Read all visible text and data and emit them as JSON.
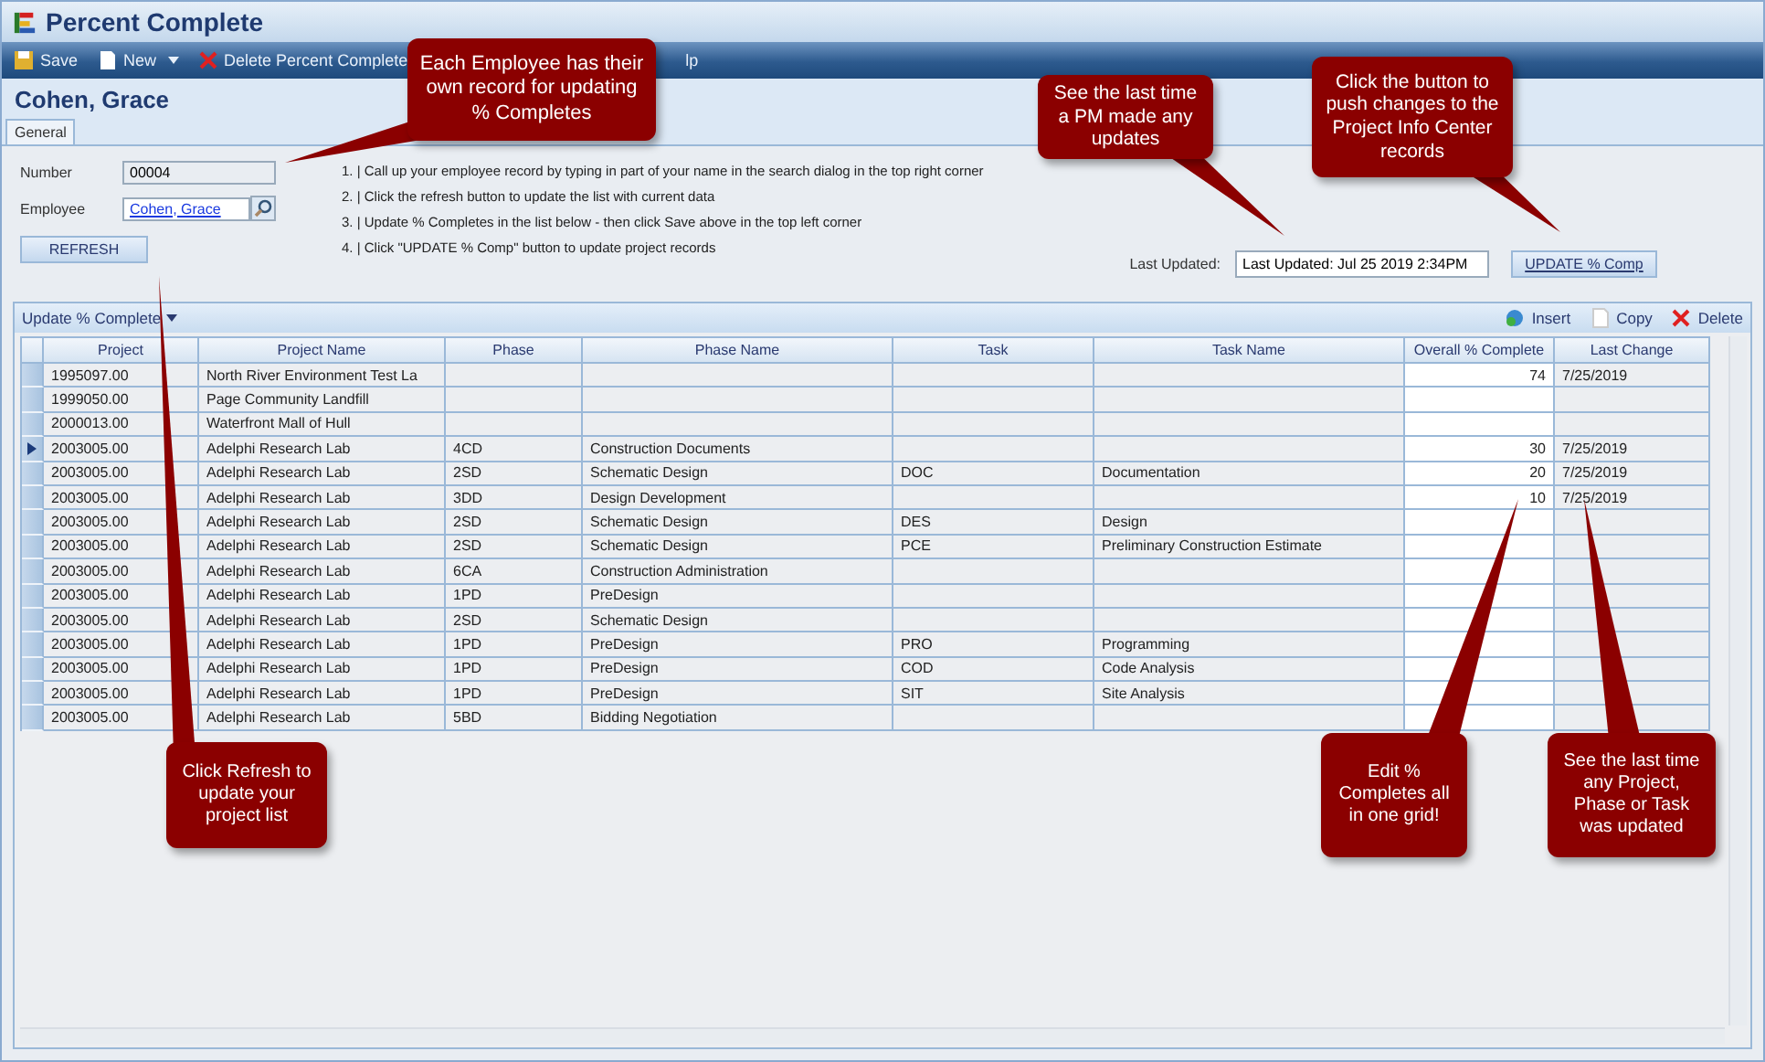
{
  "window": {
    "title": "Percent Complete"
  },
  "toolbar": [
    {
      "label": "Save",
      "kind": "save",
      "dropdown": false
    },
    {
      "label": "New",
      "kind": "new",
      "dropdown": true
    },
    {
      "label": "Delete Percent Complete",
      "kind": "delete",
      "dropdown": false
    },
    {
      "label": "lp",
      "kind": "plain",
      "dropdown": false
    }
  ],
  "record_title": "Cohen, Grace",
  "tabs": [
    {
      "label": "General",
      "selected": true
    }
  ],
  "form": {
    "number_label": "Number",
    "number_value": "00004",
    "employee_label": "Employee",
    "employee_value": "Cohen, Grace",
    "refresh_button": "REFRESH"
  },
  "instructions": [
    "1. | Call up your employee record by typing in part of your name in the search dialog in the top right corner",
    "2. | Click the refresh button to update the list with current data",
    "3. | Update % Completes in the list below - then click Save above in the top left corner",
    "4. | Click \"UPDATE % Comp\" button to update project records"
  ],
  "last_updated": {
    "label": "Last Updated:",
    "value": "Last Updated: Jul 25 2019  2:34PM"
  },
  "update_button": "UPDATE % Comp",
  "grid": {
    "title": "Update % Complete",
    "actions": [
      {
        "label": "Insert",
        "kind": "insert"
      },
      {
        "label": "Copy",
        "kind": "copy"
      },
      {
        "label": "Delete",
        "kind": "delete"
      }
    ],
    "columns": [
      {
        "label": "Project",
        "kind": "text"
      },
      {
        "label": "Project Name",
        "kind": "text"
      },
      {
        "label": "Phase",
        "kind": "text"
      },
      {
        "label": "Phase Name",
        "kind": "text"
      },
      {
        "label": "Task",
        "kind": "text"
      },
      {
        "label": "Task Name",
        "kind": "text"
      },
      {
        "label": "Overall % Complete",
        "kind": "editable"
      },
      {
        "label": "Last Change",
        "kind": "text"
      }
    ],
    "rows": [
      {
        "current": false,
        "cells": [
          "1995097.00",
          "North River Environment Test La",
          "",
          "",
          "",
          "",
          "74",
          "7/25/2019"
        ]
      },
      {
        "current": false,
        "cells": [
          "1999050.00",
          "Page Community Landfill",
          "",
          "",
          "",
          "",
          "",
          ""
        ]
      },
      {
        "current": false,
        "cells": [
          "2000013.00",
          "Waterfront Mall of Hull",
          "",
          "",
          "",
          "",
          "",
          ""
        ]
      },
      {
        "current": true,
        "cells": [
          "2003005.00",
          "Adelphi Research Lab",
          "4CD",
          "Construction Documents",
          "",
          "",
          "30",
          "7/25/2019"
        ]
      },
      {
        "current": false,
        "cells": [
          "2003005.00",
          "Adelphi Research Lab",
          "2SD",
          "Schematic Design",
          "DOC",
          "Documentation",
          "20",
          "7/25/2019"
        ]
      },
      {
        "current": false,
        "cells": [
          "2003005.00",
          "Adelphi Research Lab",
          "3DD",
          "Design Development",
          "",
          "",
          "10",
          "7/25/2019"
        ]
      },
      {
        "current": false,
        "cells": [
          "2003005.00",
          "Adelphi Research Lab",
          "2SD",
          "Schematic Design",
          "DES",
          "Design",
          "",
          ""
        ]
      },
      {
        "current": false,
        "cells": [
          "2003005.00",
          "Adelphi Research Lab",
          "2SD",
          "Schematic Design",
          "PCE",
          "Preliminary Construction Estimate",
          "",
          ""
        ]
      },
      {
        "current": false,
        "cells": [
          "2003005.00",
          "Adelphi Research Lab",
          "6CA",
          "Construction Administration",
          "",
          "",
          "",
          ""
        ]
      },
      {
        "current": false,
        "cells": [
          "2003005.00",
          "Adelphi Research Lab",
          "1PD",
          "PreDesign",
          "",
          "",
          "",
          ""
        ]
      },
      {
        "current": false,
        "cells": [
          "2003005.00",
          "Adelphi Research Lab",
          "2SD",
          "Schematic Design",
          "",
          "",
          "",
          ""
        ]
      },
      {
        "current": false,
        "cells": [
          "2003005.00",
          "Adelphi Research Lab",
          "1PD",
          "PreDesign",
          "PRO",
          "Programming",
          "",
          ""
        ]
      },
      {
        "current": false,
        "cells": [
          "2003005.00",
          "Adelphi Research Lab",
          "1PD",
          "PreDesign",
          "COD",
          "Code Analysis",
          "",
          ""
        ]
      },
      {
        "current": false,
        "cells": [
          "2003005.00",
          "Adelphi Research Lab",
          "1PD",
          "PreDesign",
          "SIT",
          "Site Analysis",
          "",
          ""
        ]
      },
      {
        "current": false,
        "cells": [
          "2003005.00",
          "Adelphi Research Lab",
          "5BD",
          "Bidding Negotiation",
          "",
          "",
          "",
          ""
        ]
      }
    ]
  },
  "callouts": [
    {
      "text": "Each Employee has their own record for updating % Completes"
    },
    {
      "text": "See the last time a PM made any updates"
    },
    {
      "text": "Click the button to push changes to the Project Info Center records"
    },
    {
      "text": "Click Refresh to update your project list"
    },
    {
      "text": "Edit % Completes all in one grid!"
    },
    {
      "text": "See the last time any Project, Phase or Task was updated"
    }
  ]
}
